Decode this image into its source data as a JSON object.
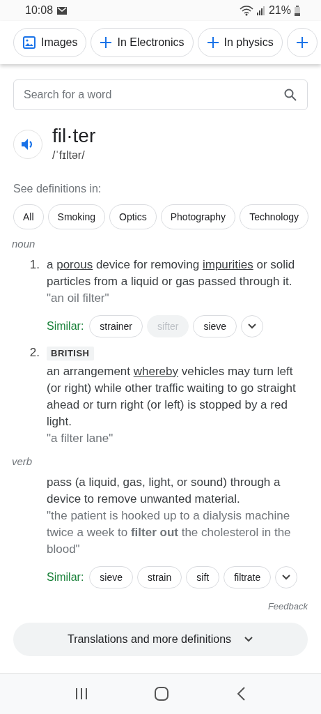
{
  "status_bar": {
    "time": "10:08",
    "battery": "21%"
  },
  "chips": [
    {
      "label": "Images",
      "kind": "image"
    },
    {
      "label": "In Electronics",
      "kind": "plus"
    },
    {
      "label": "In physics",
      "kind": "plus"
    },
    {
      "kind": "plus"
    }
  ],
  "search": {
    "placeholder": "Search for a word"
  },
  "entry": {
    "word": "fil·ter",
    "pronunciation": "/ˈfɪltər/"
  },
  "see_in": {
    "label": "See definitions in:",
    "categories": [
      "All",
      "Smoking",
      "Optics",
      "Photography",
      "Technology"
    ]
  },
  "senses": [
    {
      "pos": "noun",
      "definitions": [
        {
          "number": "1.",
          "parts": [
            {
              "text": "a "
            },
            {
              "text": "porous",
              "link": true
            },
            {
              "text": " device for removing "
            },
            {
              "text": "impurities",
              "link": true
            },
            {
              "text": " or solid particles from a liquid or gas passed through it."
            }
          ],
          "example": "\"an oil filter\"",
          "similar_label": "Similar:",
          "similar": [
            {
              "word": "strainer",
              "disabled": false
            },
            {
              "word": "sifter",
              "disabled": true
            },
            {
              "word": "sieve",
              "disabled": false
            }
          ]
        },
        {
          "number": "2.",
          "tag": "BRITISH",
          "parts": [
            {
              "text": "an arrangement "
            },
            {
              "text": "whereby",
              "link": true
            },
            {
              "text": " vehicles may turn left (or right) while other traffic waiting to go straight ahead or turn right (or left) is stopped by a red light."
            }
          ],
          "example": "\"a filter lane\""
        }
      ]
    },
    {
      "pos": "verb",
      "definitions": [
        {
          "parts": [
            {
              "text": "pass (a liquid, gas, light, or sound) through a device to remove unwanted material."
            }
          ],
          "example": "\"the patient is hooked up to a dialysis machine twice a week to **filter out** the cholesterol in the blood\"",
          "similar_label": "Similar:",
          "similar": [
            {
              "word": "sieve",
              "disabled": false
            },
            {
              "word": "strain",
              "disabled": false
            },
            {
              "word": "sift",
              "disabled": false
            },
            {
              "word": "filtrate",
              "disabled": false
            }
          ]
        }
      ]
    }
  ],
  "feedback": "Feedback",
  "more_button": "Translations and more definitions"
}
